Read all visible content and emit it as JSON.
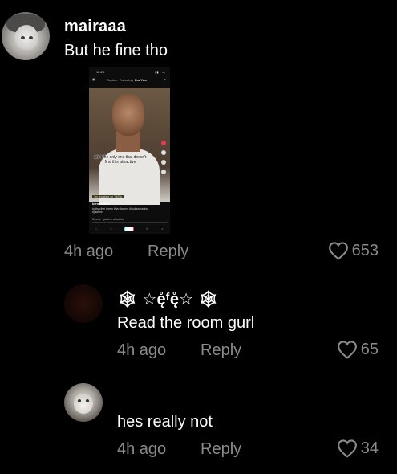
{
  "comment": {
    "username": "mairaaa",
    "text": "But he fine tho",
    "time": "4h ago",
    "reply_label": "Reply",
    "likes": "653",
    "embedded_screenshot": {
      "status_time": "12:28",
      "tabs": [
        "Explore",
        "Following",
        "For You"
      ],
      "active_tab": "For You",
      "caption": "am i the only one that doesn't find this attractive",
      "tag": "Try template on TikTok",
      "uploader": "bienes007z",
      "description": "#attractive #men #fyp #genre #lookssmaxing #jawline",
      "search_text": "Search · jawline attractive",
      "bottom_tabs": [
        "Home",
        "Friends",
        "",
        "Inbox",
        "Profile"
      ]
    }
  },
  "replies": [
    {
      "username": "🕸 ☆ę̊ᶠę̊☆ 🕸",
      "text": "Read the room gurl",
      "time": "4h ago",
      "reply_label": "Reply",
      "likes": "65"
    },
    {
      "username": "",
      "text": "hes really not",
      "time": "4h ago",
      "reply_label": "Reply",
      "likes": "34"
    }
  ],
  "colors": {
    "background": "#000000",
    "primary_text": "#ffffff",
    "secondary_text": "#8a8a8a"
  }
}
